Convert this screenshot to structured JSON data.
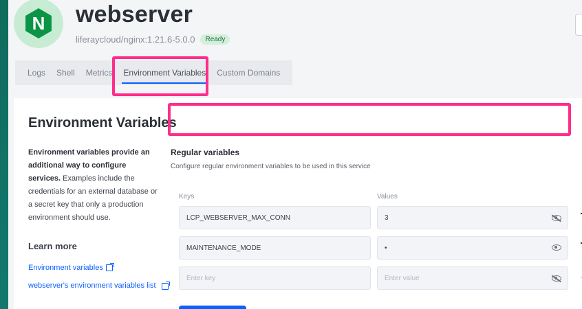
{
  "service": {
    "title": "webserver",
    "image": "liferaycloud/nginx:1.21.6-5.0.0",
    "status": "Ready",
    "logo_letter": "N",
    "logo_icon": "nginx-logo"
  },
  "tabs": [
    {
      "label": "Logs"
    },
    {
      "label": "Shell"
    },
    {
      "label": "Metrics"
    },
    {
      "label": "Environment Variables",
      "active": true
    },
    {
      "label": "Custom Domains"
    }
  ],
  "section": {
    "title": "Environment Variables",
    "desc_bold": "Environment variables provide an additional way to configure services.",
    "desc_rest": "Examples include the credentials for an external database or a secret key that only a production environment should use.",
    "learn_more": "Learn more",
    "links": [
      {
        "label": "Environment variables"
      },
      {
        "label": "webserver's environment variables list"
      }
    ]
  },
  "regular": {
    "title": "Regular variables",
    "subtitle": "Configure regular environment variables to be used in this service",
    "keys_label": "Keys",
    "values_label": "Values",
    "rows": [
      {
        "key": "LCP_WEBSERVER_MAX_CONN",
        "value": "3",
        "visibility_icon": "eye-off-icon"
      },
      {
        "key": "MAINTENANCE_MODE",
        "value": "•",
        "visibility_icon": "eye-icon"
      }
    ],
    "new_row": {
      "key_placeholder": "Enter key",
      "value_placeholder": "Enter value"
    }
  },
  "colors": {
    "accent": "#0b5fff",
    "highlight": "#ff2d8a",
    "status_bg": "#d4f0dd"
  }
}
